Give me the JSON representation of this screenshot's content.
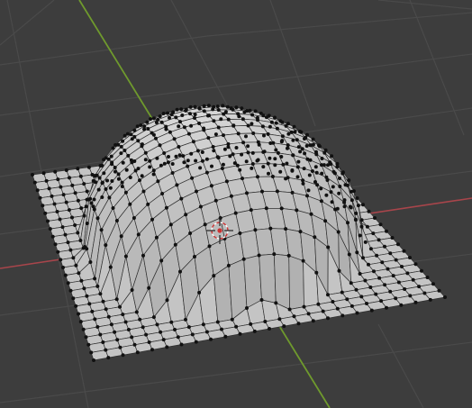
{
  "viewport": {
    "background": "#3d3d3d",
    "grid_color": "#4a4a4a",
    "x_axis_color": "#a8454b",
    "y_axis_color": "#6f9a2d",
    "mesh_face_color": "#c8c8c8",
    "mesh_edge_color": "#2f2f2f",
    "vertex_color": "#111111",
    "cursor_colors": [
      "#ffffff",
      "#cc3333"
    ],
    "subdivisions": 24
  }
}
